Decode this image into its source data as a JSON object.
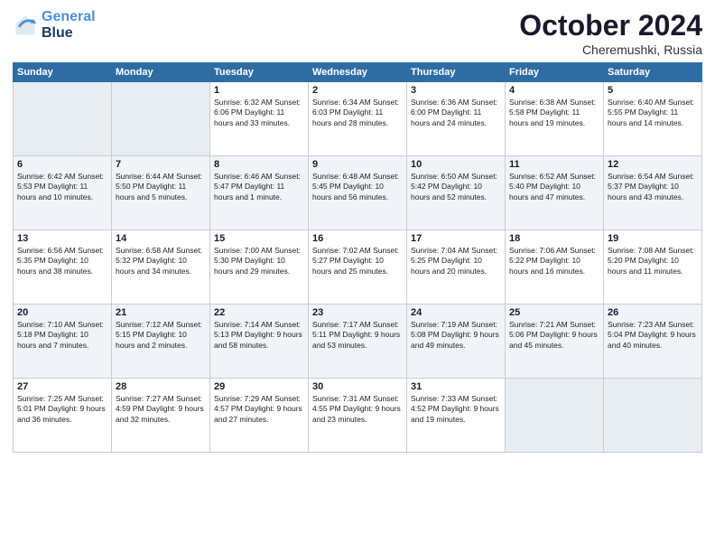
{
  "header": {
    "logo_line1": "General",
    "logo_line2": "Blue",
    "month": "October 2024",
    "location": "Cheremushki, Russia"
  },
  "days_of_week": [
    "Sunday",
    "Monday",
    "Tuesday",
    "Wednesday",
    "Thursday",
    "Friday",
    "Saturday"
  ],
  "weeks": [
    [
      {
        "day": "",
        "info": ""
      },
      {
        "day": "",
        "info": ""
      },
      {
        "day": "1",
        "info": "Sunrise: 6:32 AM\nSunset: 6:06 PM\nDaylight: 11 hours and 33 minutes."
      },
      {
        "day": "2",
        "info": "Sunrise: 6:34 AM\nSunset: 6:03 PM\nDaylight: 11 hours and 28 minutes."
      },
      {
        "day": "3",
        "info": "Sunrise: 6:36 AM\nSunset: 6:00 PM\nDaylight: 11 hours and 24 minutes."
      },
      {
        "day": "4",
        "info": "Sunrise: 6:38 AM\nSunset: 5:58 PM\nDaylight: 11 hours and 19 minutes."
      },
      {
        "day": "5",
        "info": "Sunrise: 6:40 AM\nSunset: 5:55 PM\nDaylight: 11 hours and 14 minutes."
      }
    ],
    [
      {
        "day": "6",
        "info": "Sunrise: 6:42 AM\nSunset: 5:53 PM\nDaylight: 11 hours and 10 minutes."
      },
      {
        "day": "7",
        "info": "Sunrise: 6:44 AM\nSunset: 5:50 PM\nDaylight: 11 hours and 5 minutes."
      },
      {
        "day": "8",
        "info": "Sunrise: 6:46 AM\nSunset: 5:47 PM\nDaylight: 11 hours and 1 minute."
      },
      {
        "day": "9",
        "info": "Sunrise: 6:48 AM\nSunset: 5:45 PM\nDaylight: 10 hours and 56 minutes."
      },
      {
        "day": "10",
        "info": "Sunrise: 6:50 AM\nSunset: 5:42 PM\nDaylight: 10 hours and 52 minutes."
      },
      {
        "day": "11",
        "info": "Sunrise: 6:52 AM\nSunset: 5:40 PM\nDaylight: 10 hours and 47 minutes."
      },
      {
        "day": "12",
        "info": "Sunrise: 6:54 AM\nSunset: 5:37 PM\nDaylight: 10 hours and 43 minutes."
      }
    ],
    [
      {
        "day": "13",
        "info": "Sunrise: 6:56 AM\nSunset: 5:35 PM\nDaylight: 10 hours and 38 minutes."
      },
      {
        "day": "14",
        "info": "Sunrise: 6:58 AM\nSunset: 5:32 PM\nDaylight: 10 hours and 34 minutes."
      },
      {
        "day": "15",
        "info": "Sunrise: 7:00 AM\nSunset: 5:30 PM\nDaylight: 10 hours and 29 minutes."
      },
      {
        "day": "16",
        "info": "Sunrise: 7:02 AM\nSunset: 5:27 PM\nDaylight: 10 hours and 25 minutes."
      },
      {
        "day": "17",
        "info": "Sunrise: 7:04 AM\nSunset: 5:25 PM\nDaylight: 10 hours and 20 minutes."
      },
      {
        "day": "18",
        "info": "Sunrise: 7:06 AM\nSunset: 5:22 PM\nDaylight: 10 hours and 16 minutes."
      },
      {
        "day": "19",
        "info": "Sunrise: 7:08 AM\nSunset: 5:20 PM\nDaylight: 10 hours and 11 minutes."
      }
    ],
    [
      {
        "day": "20",
        "info": "Sunrise: 7:10 AM\nSunset: 5:18 PM\nDaylight: 10 hours and 7 minutes."
      },
      {
        "day": "21",
        "info": "Sunrise: 7:12 AM\nSunset: 5:15 PM\nDaylight: 10 hours and 2 minutes."
      },
      {
        "day": "22",
        "info": "Sunrise: 7:14 AM\nSunset: 5:13 PM\nDaylight: 9 hours and 58 minutes."
      },
      {
        "day": "23",
        "info": "Sunrise: 7:17 AM\nSunset: 5:11 PM\nDaylight: 9 hours and 53 minutes."
      },
      {
        "day": "24",
        "info": "Sunrise: 7:19 AM\nSunset: 5:08 PM\nDaylight: 9 hours and 49 minutes."
      },
      {
        "day": "25",
        "info": "Sunrise: 7:21 AM\nSunset: 5:06 PM\nDaylight: 9 hours and 45 minutes."
      },
      {
        "day": "26",
        "info": "Sunrise: 7:23 AM\nSunset: 5:04 PM\nDaylight: 9 hours and 40 minutes."
      }
    ],
    [
      {
        "day": "27",
        "info": "Sunrise: 7:25 AM\nSunset: 5:01 PM\nDaylight: 9 hours and 36 minutes."
      },
      {
        "day": "28",
        "info": "Sunrise: 7:27 AM\nSunset: 4:59 PM\nDaylight: 9 hours and 32 minutes."
      },
      {
        "day": "29",
        "info": "Sunrise: 7:29 AM\nSunset: 4:57 PM\nDaylight: 9 hours and 27 minutes."
      },
      {
        "day": "30",
        "info": "Sunrise: 7:31 AM\nSunset: 4:55 PM\nDaylight: 9 hours and 23 minutes."
      },
      {
        "day": "31",
        "info": "Sunrise: 7:33 AM\nSunset: 4:52 PM\nDaylight: 9 hours and 19 minutes."
      },
      {
        "day": "",
        "info": ""
      },
      {
        "day": "",
        "info": ""
      }
    ]
  ]
}
